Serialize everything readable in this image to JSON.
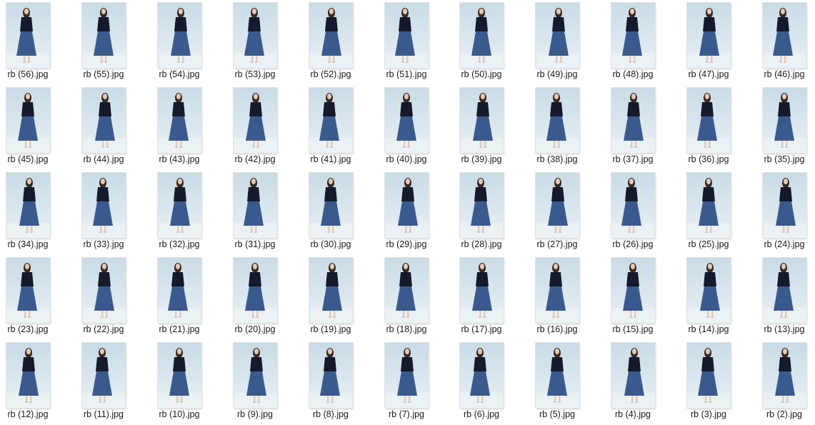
{
  "files": [
    "rb (56).jpg",
    "rb (55).jpg",
    "rb (54).jpg",
    "rb (53).jpg",
    "rb (52).jpg",
    "rb (51).jpg",
    "rb (50).jpg",
    "rb (49).jpg",
    "rb (48).jpg",
    "rb (47).jpg",
    "rb (46).jpg",
    "rb (45).jpg",
    "rb (44).jpg",
    "rb (43).jpg",
    "rb (42).jpg",
    "rb (41).jpg",
    "rb (40).jpg",
    "rb (39).jpg",
    "rb (38).jpg",
    "rb (37).jpg",
    "rb (36).jpg",
    "rb (35).jpg",
    "rb (34).jpg",
    "rb (33).jpg",
    "rb (32).jpg",
    "rb (31).jpg",
    "rb (30).jpg",
    "rb (29).jpg",
    "rb (28).jpg",
    "rb (27).jpg",
    "rb (26).jpg",
    "rb (25).jpg",
    "rb (24).jpg",
    "rb (23).jpg",
    "rb (22).jpg",
    "rb (21).jpg",
    "rb (20).jpg",
    "rb (19).jpg",
    "rb (18).jpg",
    "rb (17).jpg",
    "rb (16).jpg",
    "rb (15).jpg",
    "rb (14).jpg",
    "rb (13).jpg",
    "rb (12).jpg",
    "rb (11).jpg",
    "rb (10).jpg",
    "rb (9).jpg",
    "rb (8).jpg",
    "rb (7).jpg",
    "rb (6).jpg",
    "rb (5).jpg",
    "rb (4).jpg",
    "rb (3).jpg",
    "rb (2).jpg"
  ],
  "colors": {
    "background": "#ffffff",
    "label_text": "#1a1a1a",
    "backdrop_top": "#c9dbe6",
    "backdrop_bottom": "#e8f0f4",
    "jacket": "#141a2c",
    "skirt": "#3a5a8e",
    "skin": "#e7c9b5",
    "hair": "#3a2a22"
  },
  "icons": {
    "thumbnail": "photo-thumbnail-icon"
  }
}
